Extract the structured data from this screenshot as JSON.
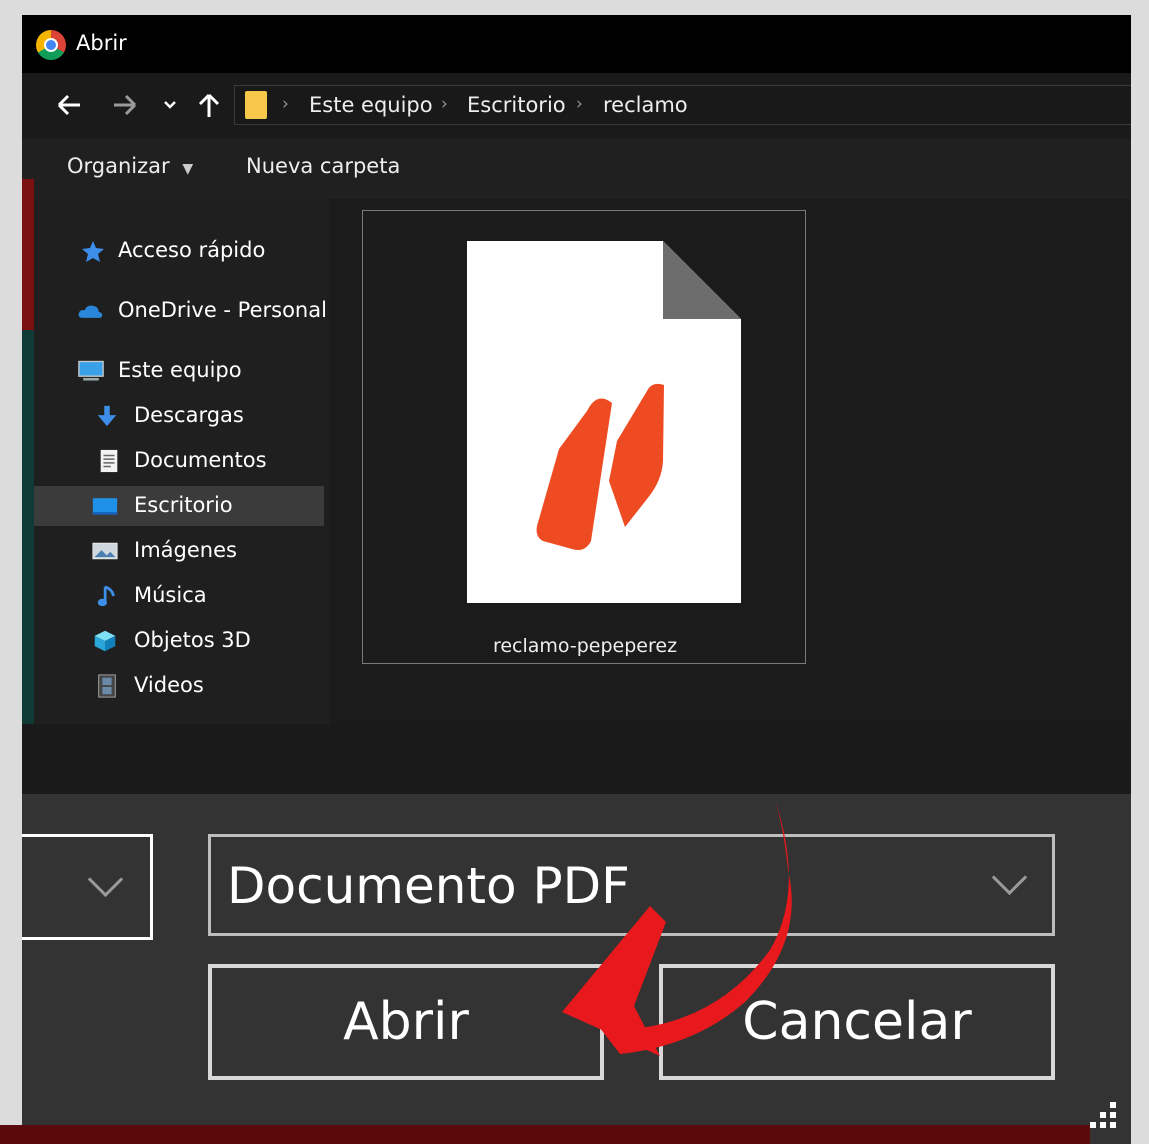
{
  "window": {
    "title": "Abrir",
    "app_icon": "chrome-icon"
  },
  "navigation": {
    "back_icon": "arrow-left-icon",
    "forward_icon": "arrow-right-icon",
    "recent_icon": "chevron-down-icon",
    "up_icon": "arrow-up-icon",
    "breadcrumb": [
      "Este equipo",
      "Escritorio",
      "reclamo"
    ],
    "separator": "›"
  },
  "toolbar": {
    "organize_label": "Organizar",
    "new_folder_label": "Nueva carpeta"
  },
  "sidebar": {
    "items": [
      {
        "label": "Acceso rápido",
        "icon": "star-icon"
      },
      {
        "label": "OneDrive - Personal",
        "icon": "cloud-icon"
      },
      {
        "label": "Este equipo",
        "icon": "computer-icon"
      },
      {
        "label": "Descargas",
        "icon": "download-icon"
      },
      {
        "label": "Documentos",
        "icon": "document-icon"
      },
      {
        "label": "Escritorio",
        "icon": "desktop-icon",
        "selected": true
      },
      {
        "label": "Imágenes",
        "icon": "image-icon"
      },
      {
        "label": "Música",
        "icon": "music-icon"
      },
      {
        "label": "Objetos 3D",
        "icon": "cube-icon"
      },
      {
        "label": "Videos",
        "icon": "film-icon"
      }
    ]
  },
  "files": [
    {
      "name": "reclamo-pepeperez",
      "icon": "pdf-file-icon"
    }
  ],
  "footer": {
    "file_type": "Documento PDF",
    "open_label": "Abrir",
    "cancel_label": "Cancelar"
  },
  "colors": {
    "accent_arrow": "#e8191c",
    "pdf_logo": "#ee4b22",
    "selected_item": "#3b3b3b"
  }
}
